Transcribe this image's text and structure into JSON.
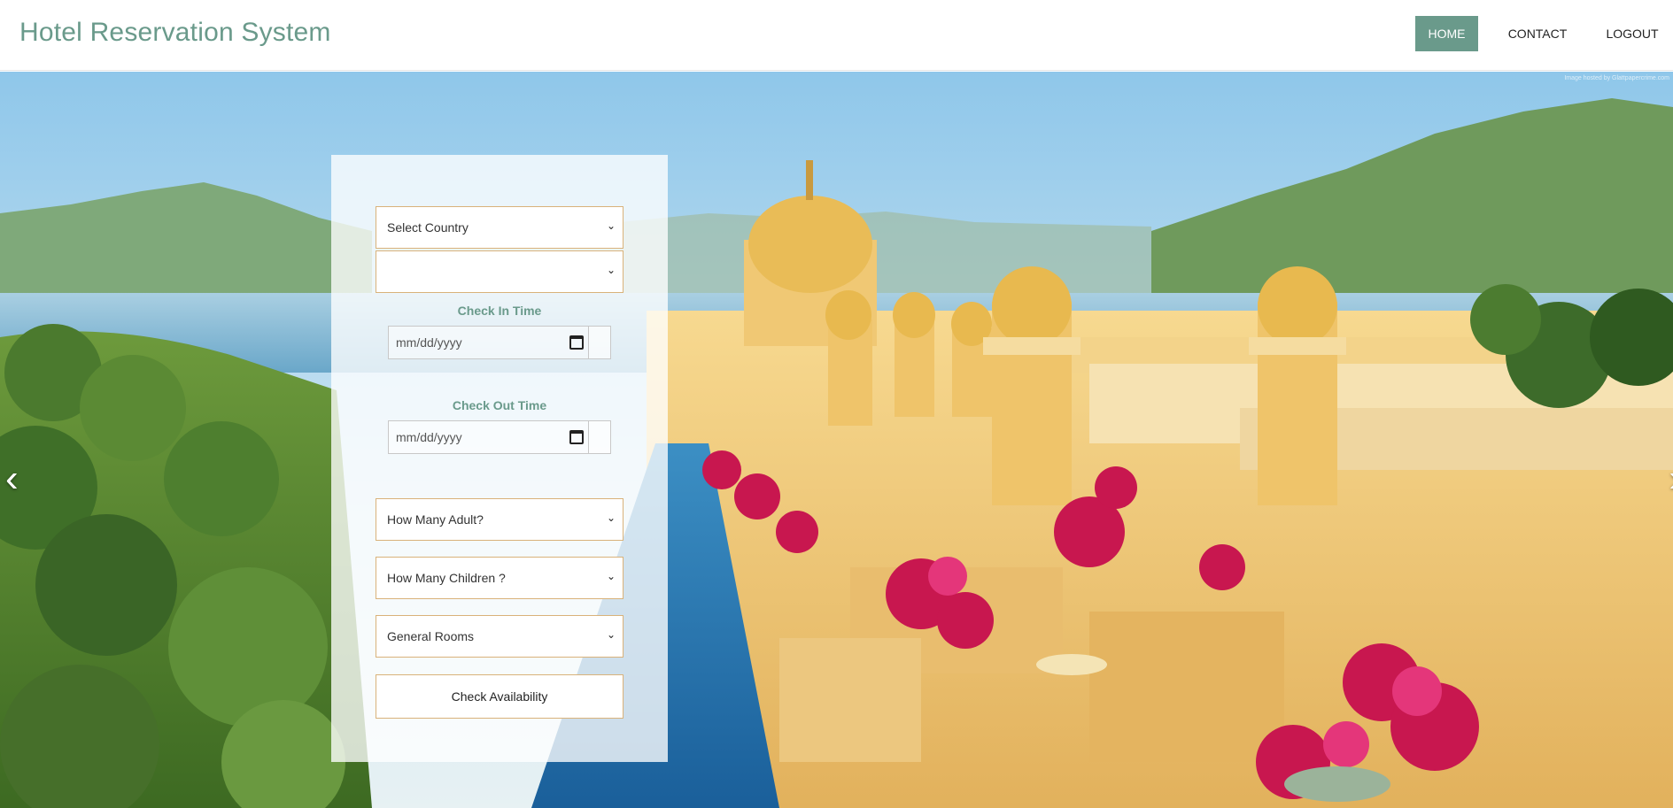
{
  "header": {
    "title": "Hotel Reservation System",
    "nav": [
      {
        "label": "HOME",
        "active": true
      },
      {
        "label": "CONTACT",
        "active": false
      },
      {
        "label": "LOGOUT",
        "active": false
      }
    ]
  },
  "hero": {
    "credit": "Image hosted by Glattpapercrime.com",
    "prev_icon": "chevron-left-icon",
    "next_icon": "chevron-right-icon"
  },
  "form": {
    "country_select": "Select Country",
    "second_select": "",
    "check_in_label": "Check In Time",
    "check_in_placeholder": "mm/dd/yyyy",
    "check_out_label": "Check Out Time",
    "check_out_placeholder": "mm/dd/yyyy",
    "adult_select": "How Many Adult?",
    "children_select": "How Many Children ?",
    "room_select": "General Rooms",
    "submit_label": "Check Availability"
  },
  "colors": {
    "brand": "#6a9a8b",
    "field_border": "#d9b27a"
  }
}
